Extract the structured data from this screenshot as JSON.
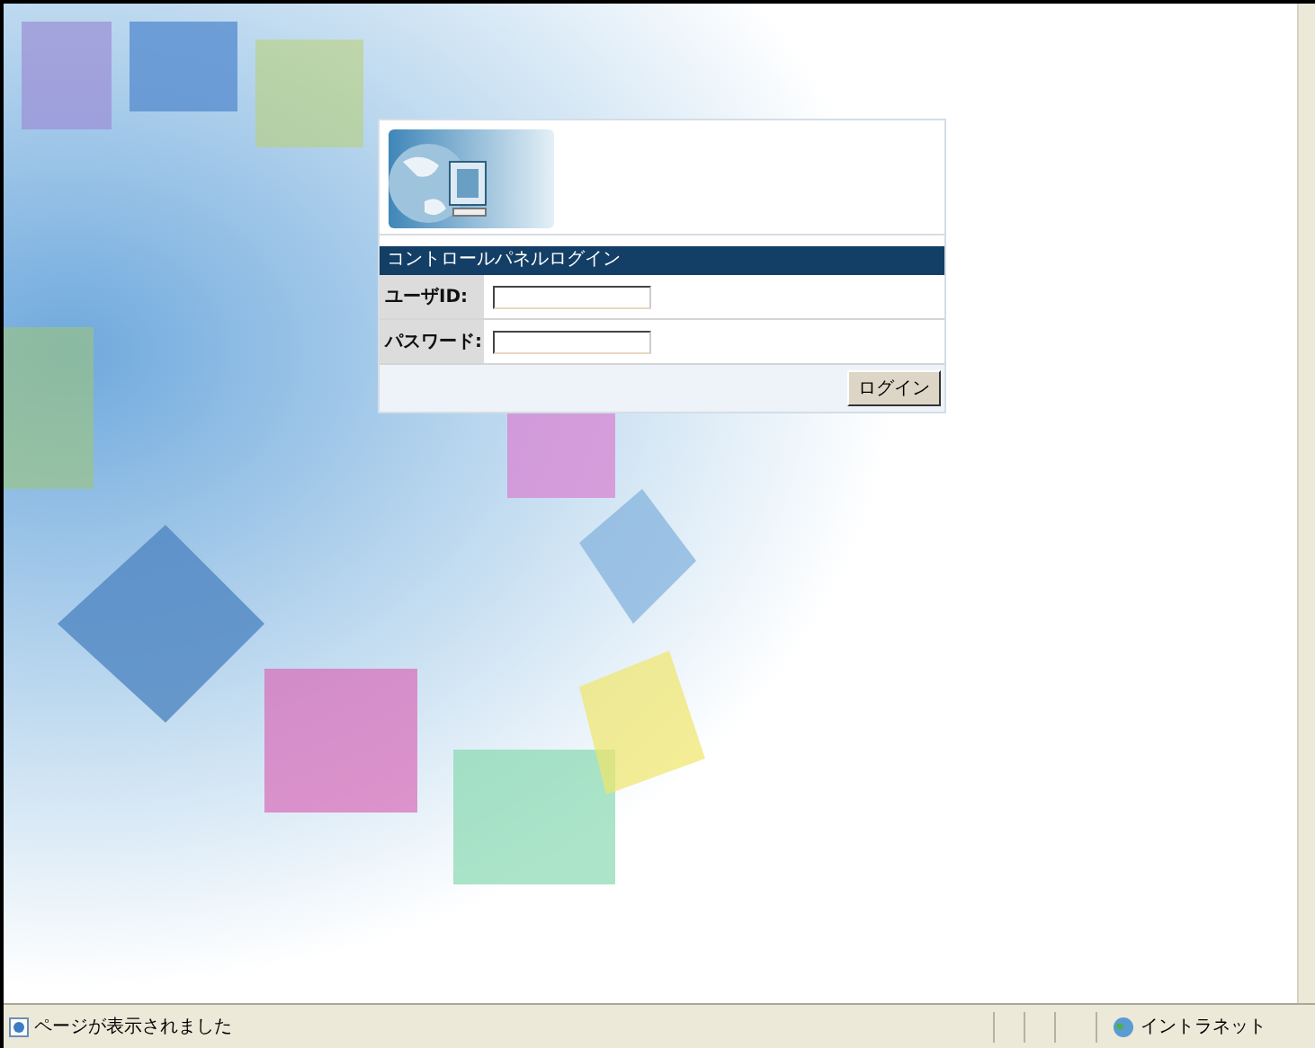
{
  "login_panel": {
    "title": "コントロールパネルログイン",
    "fields": [
      {
        "label": "ユーザID:"
      },
      {
        "label": "パスワード:"
      }
    ],
    "button": "ログイン"
  },
  "status_bar": {
    "message": "ページが表示されました",
    "zone": "イントラネット"
  }
}
